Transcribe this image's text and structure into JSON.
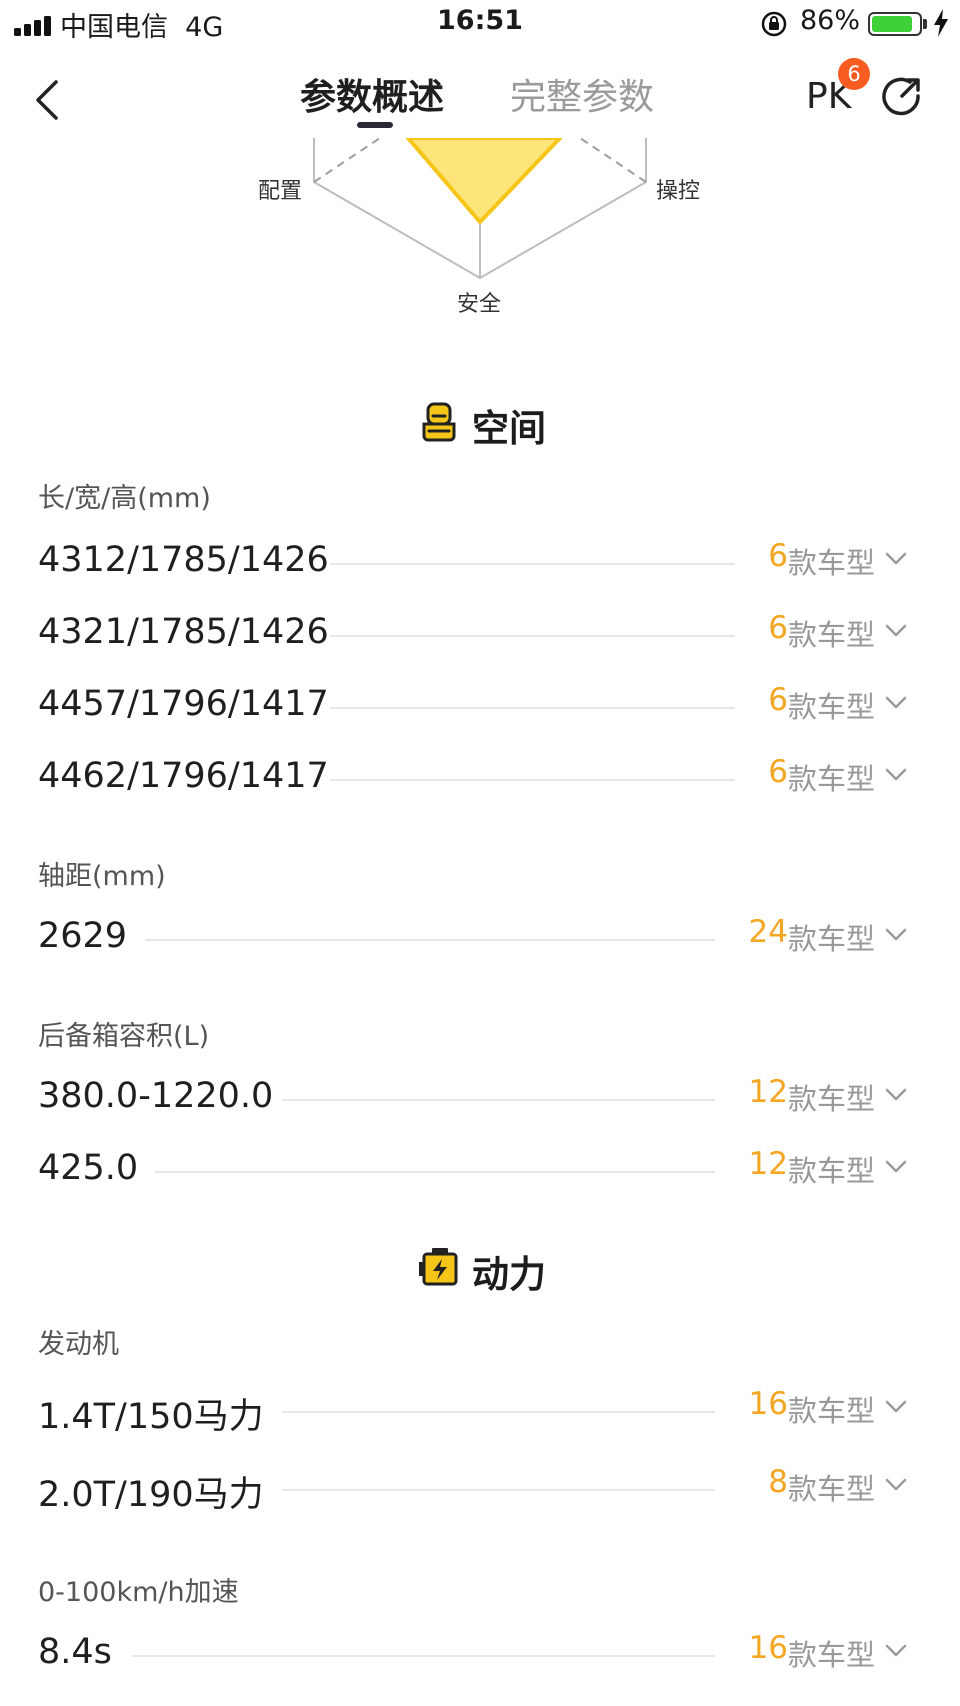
{
  "status_bar": {
    "carrier": "中国电信",
    "network": "4G",
    "time": "16:51",
    "battery_pct": "86%",
    "battery_level": 0.86,
    "battery_color": "#3ed13a"
  },
  "nav": {
    "tabs": [
      "参数概述",
      "完整参数"
    ],
    "active_tab": 0,
    "pk_label": "PK",
    "pk_badge": "6"
  },
  "radar": {
    "labels": {
      "left": "配置",
      "right": "操控",
      "bottom": "安全"
    },
    "fill_color": "#fde57a",
    "stroke_color": "#f5c518"
  },
  "sections": {
    "space": {
      "title": "空间",
      "icon": "seat-icon",
      "groups": {
        "dimensions": {
          "label": "长/宽/高(mm)",
          "rows": [
            {
              "value": "4312/1785/1426",
              "count": "6"
            },
            {
              "value": "4321/1785/1426",
              "count": "6"
            },
            {
              "value": "4457/1796/1417",
              "count": "6"
            },
            {
              "value": "4462/1796/1417",
              "count": "6"
            }
          ]
        },
        "wheelbase": {
          "label": "轴距(mm)",
          "rows": [
            {
              "value": "2629",
              "count": "24"
            }
          ]
        },
        "trunk": {
          "label": "后备箱容积(L)",
          "rows": [
            {
              "value": "380.0-1220.0",
              "count": "12"
            },
            {
              "value": "425.0",
              "count": "12"
            }
          ]
        }
      }
    },
    "power": {
      "title": "动力",
      "icon": "battery-power-icon",
      "groups": {
        "engine": {
          "label": "发动机",
          "rows": [
            {
              "value": "1.4T/150马力",
              "count": "16"
            },
            {
              "value": "2.0T/190马力",
              "count": "8"
            }
          ]
        },
        "accel": {
          "label": "0-100km/h加速",
          "rows": [
            {
              "value": "8.4s",
              "count": "16"
            }
          ]
        }
      }
    }
  },
  "row_unit": "款车型",
  "accent_color": "#f5a623"
}
